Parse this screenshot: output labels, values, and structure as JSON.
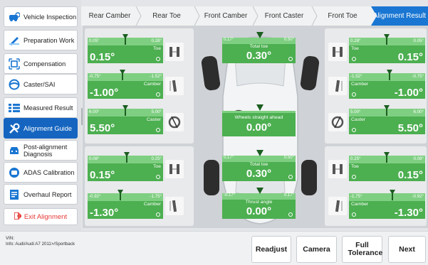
{
  "sidebar": {
    "items": [
      {
        "label": "Vehicle Inspection",
        "icon": "vehicle-inspection-icon"
      },
      {
        "label": "Preparation Work",
        "icon": "preparation-icon"
      },
      {
        "label": "Compensation",
        "icon": "compensation-icon"
      },
      {
        "label": "Caster/SAI",
        "icon": "steering-wheel-icon"
      },
      {
        "label": "Measured Result",
        "icon": "list-icon"
      },
      {
        "label": "Alignment Guide",
        "icon": "wrench-icon",
        "active": true
      },
      {
        "label": "Post-alignment Diagnosis",
        "icon": "car-diagnosis-icon"
      },
      {
        "label": "ADAS Calibration",
        "icon": "adas-icon"
      },
      {
        "label": "Overhaul Report",
        "icon": "report-icon"
      }
    ],
    "exit_label": "Exit Alignment"
  },
  "tabs": [
    "Rear Camber",
    "Rear Toe",
    "Front Camber",
    "Front Caster",
    "Front Toe",
    "Alignment Result"
  ],
  "active_tab": "Alignment Result",
  "gauges": {
    "fl_toe": {
      "min": "0.05°",
      "max": "0.28°",
      "label": "Toe",
      "value": "0.15°"
    },
    "fl_camber": {
      "min": "-0.75°",
      "max": "-1.52°",
      "label": "Camber",
      "value": "-1.00°"
    },
    "fl_caster": {
      "min": "6.00°",
      "max": "5.00°",
      "label": "Caster",
      "value": "5.50°"
    },
    "rl_toe": {
      "min": "0.08°",
      "max": "0.25°",
      "label": "Toe",
      "value": "0.15°"
    },
    "rl_camber": {
      "min": "-0.92°",
      "max": "-1.75°",
      "label": "Camber",
      "value": "-1.30°"
    },
    "fr_toe": {
      "min": "0.28°",
      "max": "0.05°",
      "label": "Toe",
      "value": "0.15°"
    },
    "fr_camber": {
      "min": "-1.52°",
      "max": "-0.75°",
      "label": "Camber",
      "value": "-1.00°"
    },
    "fr_caster": {
      "min": "5.00°",
      "max": "6.00°",
      "label": "Caster",
      "value": "5.50°"
    },
    "rr_toe": {
      "min": "0.25°",
      "max": "0.08°",
      "label": "Toe",
      "value": "0.15°"
    },
    "rr_camber": {
      "min": "-1.75°",
      "max": "-0.92°",
      "label": "Camber",
      "value": "-1.30°"
    }
  },
  "center": {
    "front_total_toe": {
      "min": "0.17°",
      "max": "0.50°",
      "label": "Total toe",
      "value": "0.30°"
    },
    "wheels_straight": {
      "label": "Wheels straight ahead",
      "value": "0.00°"
    },
    "rear_total_toe": {
      "min": "0.17°",
      "max": "0.50°",
      "label": "Total toe",
      "value": "0.30°"
    },
    "thrust_angle": {
      "min": "-0.17°",
      "max": "0.17°",
      "label": "Thrust angle",
      "value": "0.00°"
    }
  },
  "footer": {
    "vin_label": "VIN:",
    "info": "Info: Audi/Audi A7 2011>/Sportback",
    "buttons": {
      "readjust": "Readjust",
      "camera": "Camera",
      "full_tolerance": "Full Tolerance",
      "next": "Next"
    }
  },
  "colors": {
    "accent": "#1976d2",
    "gauge_green": "#4caf50",
    "exit_red": "#e53935"
  }
}
